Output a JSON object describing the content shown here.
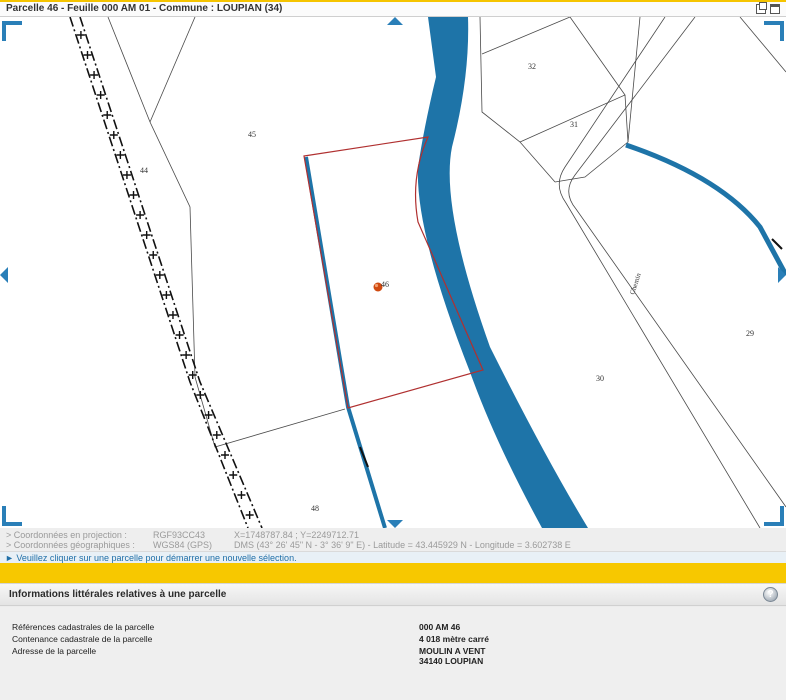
{
  "window": {
    "title": "Parcelle 46 - Feuille 000 AM 01 - Commune : LOUPIAN (34)"
  },
  "map": {
    "parcel_labels": {
      "p44": "44",
      "p45": "45",
      "p46": "46",
      "p48": "48",
      "p29": "29",
      "p30": "30",
      "p31": "31",
      "p32": "32"
    },
    "road_label": "Chemin",
    "colors": {
      "water": "#1e74a8",
      "selected_parcel": "#b03030",
      "boundary": "#4a4a4a",
      "marker": "#d04a10"
    }
  },
  "coords": {
    "projection": {
      "label": "> Coordonnées en projection :",
      "system": "RGF93CC43",
      "value": "X=1748787.84 ; Y=2249712.71"
    },
    "geographic": {
      "label": "> Coordonnées géographiques :",
      "system": "WGS84 (GPS)",
      "value": "DMS (43° 26' 45\" N - 3° 36' 9\" E) - Latitude = 43.445929 N - Longitude = 3.602738 E"
    },
    "hint": "► Veuillez cliquer sur une parcelle pour démarrer une nouvelle sélection."
  },
  "info": {
    "title": "Informations littérales relatives à une parcelle",
    "help_icon": "?",
    "rows": [
      {
        "label": "Références cadastrales de la parcelle",
        "value": "000 AM 46"
      },
      {
        "label": "Contenance cadastrale de la parcelle",
        "value": "4 018 mètre carré"
      },
      {
        "label": "Adresse de la parcelle",
        "value": "MOULIN A VENT",
        "value2": "34140 LOUPIAN"
      }
    ]
  }
}
